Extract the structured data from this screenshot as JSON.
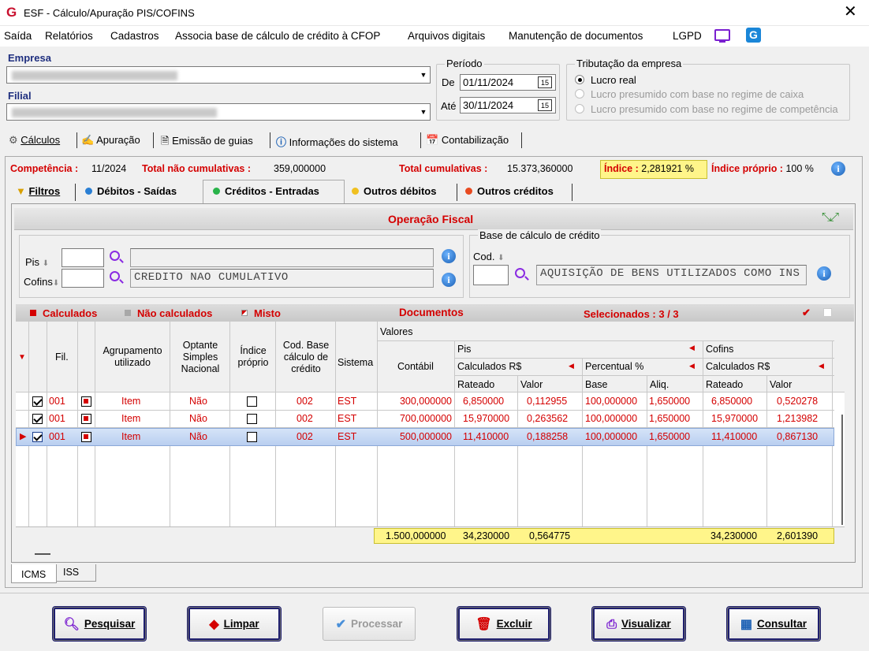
{
  "window": {
    "title": "ESF - Cálculo/Apuração PIS/COFINS",
    "logo": "G",
    "close": "✕"
  },
  "menu": [
    "Saída",
    "Relatórios",
    "Cadastros",
    "Associa base de cálculo de crédito à CFOP",
    "Arquivos digitais",
    "Manutenção de documentos",
    "LGPD"
  ],
  "empresa": {
    "label": "Empresa",
    "filial_label": "Filial"
  },
  "periodo": {
    "label": "Período",
    "de_label": "De",
    "de_value": "01/11/2024",
    "ate_label": "Até",
    "ate_value": "30/11/2024",
    "cal_icon": "15"
  },
  "tributacao": {
    "label": "Tributação da empresa",
    "options": [
      "Lucro real",
      "Lucro presumido com base no regime de caixa",
      "Lucro presumido com base no regime de competência"
    ],
    "selected": "Lucro real"
  },
  "main_tabs": [
    "Cálculos",
    "Apuração",
    "Emissão de guias",
    "Informações do sistema",
    "Contabilização"
  ],
  "summary": {
    "competencia_label": "Competência :",
    "competencia_value": "11/2024",
    "nao_cumul_label": "Total não cumulativas :",
    "nao_cumul_value": "359,000000",
    "cumul_label": "Total cumulativas :",
    "cumul_value": "15.373,360000",
    "indice_label": "Índice :",
    "indice_value": "2,281921 %",
    "indice_proprio_label": "Índice próprio :",
    "indice_proprio_value": "100 %"
  },
  "sub_tabs": [
    "Filtros",
    "Débitos - Saídas",
    "Créditos - Entradas",
    "Outros débitos",
    "Outros créditos"
  ],
  "operacao": {
    "title": "Operação Fiscal",
    "pis_label": "Pis",
    "cofins_label": "Cofins",
    "cofins_desc": "CREDITO NAO CUMULATIVO",
    "base_label": "Base de cálculo de crédito",
    "cod_label": "Cod.",
    "base_desc": "AQUISIÇÃO DE BENS UTILIZADOS COMO INS"
  },
  "grid_bar": {
    "calculados": "Calculados",
    "nao_calculados": "Não calculados",
    "misto": "Misto",
    "documentos": "Documentos",
    "selecionados": "Selecionados : 3 / 3"
  },
  "grid_headers": {
    "fil": "Fil.",
    "agrupamento": "Agrupamento utilizado",
    "optante": "Optante Simples Nacional",
    "indice_proprio": "Índice próprio",
    "cod_base": "Cod. Base cálculo de crédito",
    "sistema": "Sistema",
    "valores": "Valores",
    "contabil": "Contábil",
    "pis": "Pis",
    "cofins": "Cofins",
    "calc_rs": "Calculados R$",
    "percentual": "Percentual %",
    "rateado": "Rateado",
    "valor": "Valor",
    "base": "Base",
    "aliq": "Aliq."
  },
  "rows": [
    {
      "fil": "001",
      "agrup": "Item",
      "optante": "Não",
      "cod": "002",
      "sistema": "EST",
      "contabil": "300,000000",
      "pis_rateado": "6,850000",
      "pis_valor": "0,112955",
      "base": "100,000000",
      "aliq": "1,650000",
      "cof_rateado": "6,850000",
      "cof_valor": "0,520278"
    },
    {
      "fil": "001",
      "agrup": "Item",
      "optante": "Não",
      "cod": "002",
      "sistema": "EST",
      "contabil": "700,000000",
      "pis_rateado": "15,970000",
      "pis_valor": "0,263562",
      "base": "100,000000",
      "aliq": "1,650000",
      "cof_rateado": "15,970000",
      "cof_valor": "1,213982"
    },
    {
      "fil": "001",
      "agrup": "Item",
      "optante": "Não",
      "cod": "002",
      "sistema": "EST",
      "contabil": "500,000000",
      "pis_rateado": "11,410000",
      "pis_valor": "0,188258",
      "base": "100,000000",
      "aliq": "1,650000",
      "cof_rateado": "11,410000",
      "cof_valor": "0,867130"
    }
  ],
  "totals": {
    "contabil": "1.500,000000",
    "pis_rateado": "34,230000",
    "pis_valor": "0,564775",
    "cof_rateado": "34,230000",
    "cof_valor": "2,601390"
  },
  "bottom_tabs": [
    "ICMS",
    "ISS"
  ],
  "buttons": [
    "Pesquisar",
    "Limpar",
    "Processar",
    "Excluir",
    "Visualizar",
    "Consultar"
  ],
  "colors": {
    "accent_red": "#d40000",
    "highlight": "#fff58a",
    "selected_row": "#c5d9f5",
    "label_blue": "#1f2f7f",
    "icon_purple": "#7a1fd0"
  }
}
